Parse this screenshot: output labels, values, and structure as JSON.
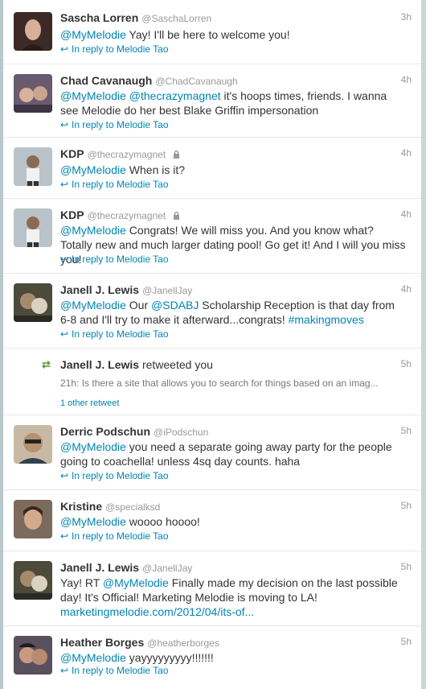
{
  "tweets": [
    {
      "name": "Sascha Lorren",
      "handle": "@SaschaLorren",
      "time": "3h",
      "mention": "@MyMelodie",
      "text": " Yay! I'll be here to welcome you!",
      "reply": "In reply to Melodie Tao"
    },
    {
      "name": "Chad Cavanaugh",
      "handle": "@ChadCavanaugh",
      "time": "4h",
      "mention": "@MyMelodie",
      "mention2": "@thecrazymagnet",
      "text": " it's hoops times, friends. I wanna see Melodie do her best Blake Griffin impersonation",
      "reply": "In reply to Melodie Tao"
    },
    {
      "name": "KDP",
      "handle": "@thecrazymagnet",
      "time": "4h",
      "mention": "@MyMelodie",
      "text": " When is it?",
      "reply": "In reply to Melodie Tao"
    },
    {
      "name": "KDP",
      "handle": "@thecrazymagnet",
      "time": "4h",
      "mention": "@MyMelodie",
      "text": " Congrats! We will miss you. And you know what? Totally new and much larger dating pool! Go get it! And I will you miss you!",
      "reply": "In reply to Melodie Tao"
    },
    {
      "name": "Janell J. Lewis",
      "handle": "@JanellJay",
      "time": "4h",
      "mention": "@MyMelodie",
      "text_a": " Our ",
      "mention2": "@SDABJ",
      "text_b": " Scholarship Reception is that day from 6-8 and I'll try to make it afterward...congrats! ",
      "hashtag": "#makingmoves",
      "reply": "In reply to Melodie Tao"
    },
    {
      "name": "Derric Podschun",
      "handle": "@iPodschun",
      "time": "5h",
      "mention": "@MyMelodie",
      "text": " you need a separate going away party for the people going to coachella! unless 4sq day counts. haha",
      "reply": "In reply to Melodie Tao"
    },
    {
      "name": "Kristine",
      "handle": "@specialksd",
      "time": "5h",
      "mention": "@MyMelodie",
      "text": " woooo hoooo!",
      "reply": "In reply to Melodie Tao"
    },
    {
      "name": "Janell J. Lewis",
      "handle": "@JanellJay",
      "time": "5h",
      "text_a": "Yay! RT ",
      "mention": "@MyMelodie",
      "text_b": " Finally made my decision on the last possible day! It's Official! Marketing Melodie is moving to LA!",
      "link": "marketingmelodie.com/2012/04/its-of...",
      "reply": "In reply to Melodie Tao"
    },
    {
      "name": "Heather Borges",
      "handle": "@heatherborges",
      "time": "5h",
      "mention": "@MyMelodie",
      "text": " yayyyyyyyyy!!!!!!!",
      "reply": "In reply to Melodie Tao"
    }
  ],
  "retweet": {
    "name": "Janell J. Lewis",
    "action": " retweeted you",
    "time": "5h",
    "snippet": "21h: Is there a site that allows you to search for things based on an imag...",
    "other": "1 other retweet"
  },
  "icons": {
    "reply": "reply-arrow-icon",
    "lock": "lock-icon",
    "retweet": "retweet-icon"
  },
  "colors": {
    "link": "#0084b4",
    "retweet": "#5a9a3b",
    "muted": "#999999"
  }
}
